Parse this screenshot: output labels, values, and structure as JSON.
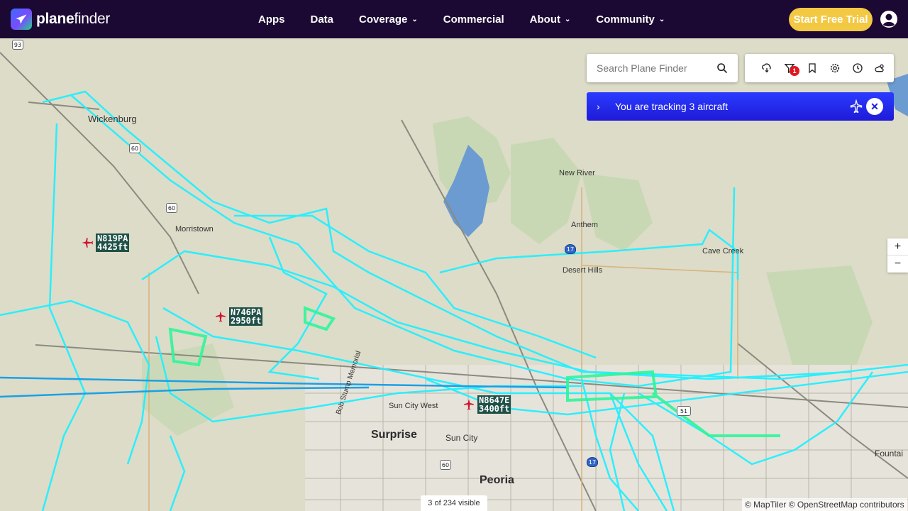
{
  "brand": {
    "name_bold": "plane",
    "name_light": "finder"
  },
  "nav": {
    "items": [
      {
        "label": "Apps",
        "dropdown": false
      },
      {
        "label": "Data",
        "dropdown": false
      },
      {
        "label": "Coverage",
        "dropdown": true
      },
      {
        "label": "Commercial",
        "dropdown": false
      },
      {
        "label": "About",
        "dropdown": true
      },
      {
        "label": "Community",
        "dropdown": true
      }
    ],
    "trial_label": "Start Free Trial"
  },
  "search": {
    "placeholder": "Search Plane Finder"
  },
  "toolbar": {
    "icons": [
      "cloud-rain-icon",
      "filter-icon",
      "bookmark-icon",
      "settings-gear-icon",
      "history-icon",
      "weather-sun-cloud-icon"
    ],
    "filter_badge": "1"
  },
  "tracking": {
    "text": "You are tracking 3 aircraft",
    "close_symbol": "✕"
  },
  "zoom": {
    "in": "+",
    "out": "−"
  },
  "status": {
    "visible_count": "3 of 234 visible"
  },
  "attribution": "© MapTiler © OpenStreetMap contributors",
  "aircraft": [
    {
      "reg": "N819PA",
      "alt": "4425ft"
    },
    {
      "reg": "N746PA",
      "alt": "2950ft"
    },
    {
      "reg": "N8647E",
      "alt": "3400ft"
    }
  ],
  "places": {
    "wickenburg": "Wickenburg",
    "morristown": "Morristown",
    "new_river": "New River",
    "anthem": "Anthem",
    "cave_creek": "Cave Creek",
    "desert_hills": "Desert Hills",
    "sun_city_west": "Sun City West",
    "surprise": "Surprise",
    "sun_city": "Sun City",
    "peoria": "Peoria",
    "fountain": "Fountai",
    "bob_stump": "Bob Stump Memorial"
  },
  "highways": {
    "us93": "93",
    "us60a": "60",
    "us60b": "60",
    "us60c": "60",
    "us60d": "60",
    "i17a": "17",
    "i17b": "17",
    "sr51": "51"
  },
  "colors": {
    "nav_bg": "#1b0833",
    "trial": "#f3c842",
    "track_cyan": "#22f0ff",
    "track_green": "#2ef59a",
    "tracking_bar": "#2a3cff"
  }
}
